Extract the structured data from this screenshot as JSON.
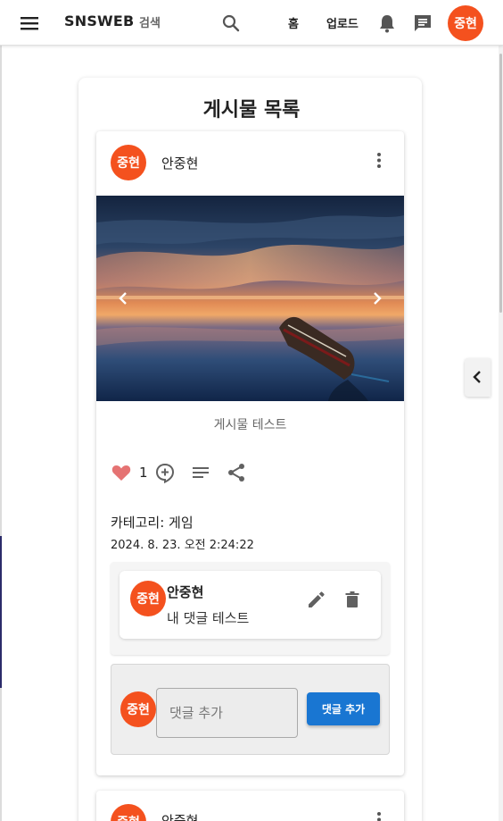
{
  "appbar": {
    "brand": "SNSWEB",
    "search_label": "검색",
    "nav_home": "홈",
    "nav_upload": "업로드",
    "user_avatar": "중현"
  },
  "page": {
    "title": "게시물 목록"
  },
  "post": {
    "avatar": "중현",
    "author": "안중현",
    "caption": "게시물 테스트",
    "likes": "1",
    "category": "카테고리: 게임",
    "date": "2024. 8. 23. 오전 2:24:22",
    "comments": [
      {
        "avatar": "중현",
        "author": "안중현",
        "text": "내 댓글 테스트"
      }
    ],
    "add_comment": {
      "avatar": "중현",
      "placeholder": "댓글 추가",
      "button": "댓글 추가"
    }
  },
  "post2": {
    "avatar": "중현",
    "author": "안중현"
  },
  "colors": {
    "avatar": "#f4511e",
    "primary": "#1976d2",
    "like": "#e57373",
    "icon": "#616161"
  },
  "icons": [
    "menu-icon",
    "search-icon",
    "bell-icon",
    "chat-icon",
    "more-vert-icon",
    "chevron-left-icon",
    "chevron-right-icon",
    "heart-icon",
    "comment-add-icon",
    "list-icon",
    "share-icon",
    "edit-icon",
    "delete-icon"
  ]
}
